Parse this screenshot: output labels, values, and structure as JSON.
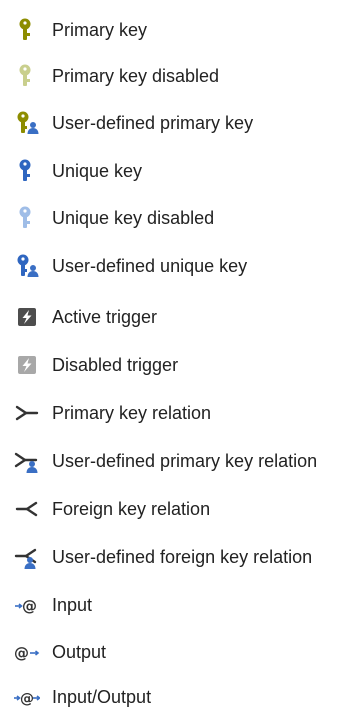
{
  "colors": {
    "key_primary": "#8d8d00",
    "key_primary_disabled": "#c9cf8d",
    "key_unique": "#2f66c0",
    "key_unique_disabled": "#9fbde7",
    "user_badge": "#3a6fc4",
    "trigger_active": "#4d4d4d",
    "trigger_disabled": "#a8a8a8",
    "relation": "#333333"
  },
  "legend": [
    {
      "icon": "primary-key-icon",
      "label": "Primary key"
    },
    {
      "icon": "primary-key-disabled-icon",
      "label": "Primary key disabled"
    },
    {
      "icon": "user-defined-primary-key-icon",
      "label": "User-defined primary key"
    },
    {
      "icon": "unique-key-icon",
      "label": "Unique key"
    },
    {
      "icon": "unique-key-disabled-icon",
      "label": "Unique key disabled"
    },
    {
      "icon": "user-defined-unique-key-icon",
      "label": "User-defined unique key"
    },
    {
      "icon": "active-trigger-icon",
      "label": "Active trigger"
    },
    {
      "icon": "disabled-trigger-icon",
      "label": "Disabled trigger"
    },
    {
      "icon": "primary-key-relation-icon",
      "label": "Primary key relation"
    },
    {
      "icon": "user-defined-primary-key-relation-icon",
      "label": "User-defined primary key relation"
    },
    {
      "icon": "foreign-key-relation-icon",
      "label": "Foreign key relation"
    },
    {
      "icon": "user-defined-foreign-key-relation-icon",
      "label": "User-defined foreign key relation"
    },
    {
      "icon": "input-icon",
      "label": "Input"
    },
    {
      "icon": "output-icon",
      "label": "Output"
    },
    {
      "icon": "input-output-icon",
      "label": "Input/Output"
    }
  ]
}
